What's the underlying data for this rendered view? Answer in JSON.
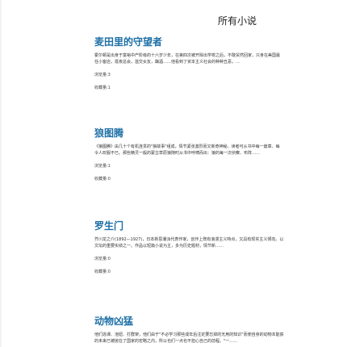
{
  "header": {
    "title": "所有小说"
  },
  "novels": [
    {
      "title": "麦田里的守望者",
      "desc_line1": "霍尔顿是出身于富裕中产阶级的十六岁少年，在第四次被开除出学校之后，不敢贸然回家，只身在美国最",
      "desc_line2": "任小客店，逛夜总会，滥交女友，酗酒……他看到了资本主义社会的种种丑恶，…",
      "views": "浏览量:3",
      "collects": "收藏量:1"
    },
    {
      "title": "狼图腾",
      "desc_line1": "《狼图腾》由几十个有机连贯的\"狼故事\"组成，情节紧张激烈而又新奇神秘。读者可从书中每一篇章、每",
      "desc_line2": "令人叹服不已。那些精灵一般的蒙古草原狼随时从书中呼啸而出：狼的每一次侦察、布阵……",
      "views": "浏览量:1",
      "collects": "收藏量:0"
    },
    {
      "title": "罗生门",
      "desc_line1": "芥川龙之介(1892—1927)，日本新思潮派代表作家，创作上既有浪漫主义特点，又具有现实主义倾向。以",
      "desc_line2": "文坛的重要实绩之一。作品以短篇小说为主，多为历史题材，情节新……",
      "views": "浏览量:0",
      "collects": "收藏量:0"
    },
    {
      "title": "动物凶猛",
      "desc_line1": "他们逃课、泡妞、打群架，他们由于\"不必学习那些成年后注定要忘掉的无用的知识\"而使自身的动物本能获",
      "desc_line2": "的未来已被抛在了国家的宏略之内，所以也们一点也不担心自己的前程。\"一……",
      "views": "",
      "collects": ""
    }
  ]
}
